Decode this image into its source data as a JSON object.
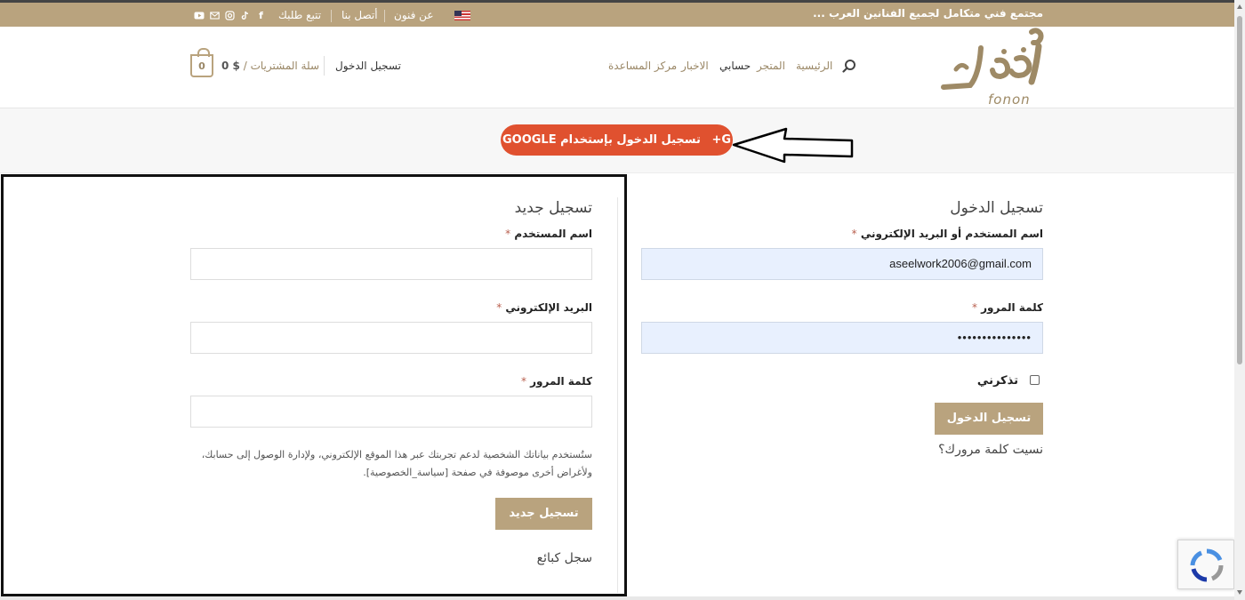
{
  "topbar": {
    "tagline": "مجتمع فني متكامل لجميع الفنانين العرب ...",
    "about": "عن فنون",
    "contact": "أتصل بنا",
    "track": "تتبع طلبك",
    "social_icons": [
      "facebook-icon",
      "tiktok-icon",
      "instagram-icon",
      "email-icon",
      "youtube-icon"
    ],
    "color": "#b9a37e"
  },
  "header": {
    "logo_latin": "fonon",
    "nav": {
      "home": "الرئيسية",
      "store": "المتجر",
      "account": "حسابي",
      "news": "الاخبار",
      "help": "مركز المساعدة"
    },
    "login": "تسجيل الدخول",
    "cart_label": "سلة المشتريات /",
    "cart_amount": "$ 0",
    "cart_count": "0"
  },
  "google": {
    "label": "تسجيل الدخول بإستخدام GOOGLE",
    "icon": "G+",
    "color": "#e0512f"
  },
  "login_form": {
    "title": "تسجيل الدخول",
    "username_label": "اسم المستخدم أو البريد الإلكتروني",
    "username_value": "aseelwork2006@gmail.com",
    "password_label": "كلمة المرور",
    "password_value": "•••••••••••••••",
    "remember": "تذكرني",
    "submit": "تسجيل الدخول",
    "forgot": "نسيت كلمة مرورك؟"
  },
  "register_form": {
    "title": "تسجيل جديد",
    "username_label": "اسم المستخدم",
    "email_label": "البريد الإلكتروني",
    "password_label": "كلمة المرور",
    "privacy_text": "ستُستخدم بياناتك الشخصية لدعم تجربتك عبر هذا الموقع الإلكتروني، ولإدارة الوصول إلى حسابك، ولأغراض أخرى موصوفة في صفحة [سياسة_الخصوصية].",
    "submit": "تسجيل جديد",
    "seller": "سجل كبائع"
  },
  "required_mark": "*"
}
